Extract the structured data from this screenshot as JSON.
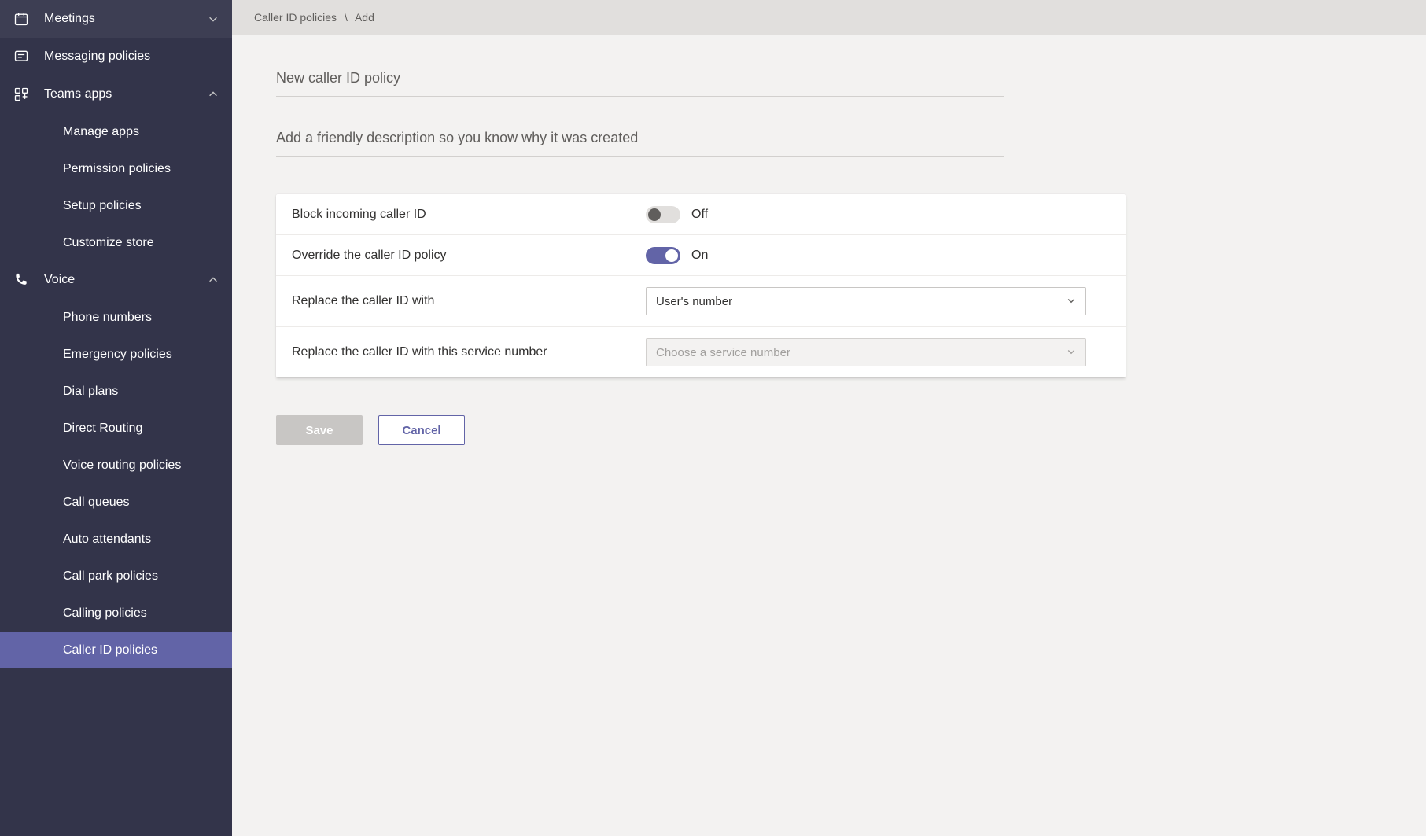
{
  "breadcrumb": {
    "root": "Caller ID policies",
    "current": "Add"
  },
  "inputs": {
    "name_placeholder": "New caller ID policy",
    "desc_placeholder": "Add a friendly description so you know why it was created"
  },
  "settings": {
    "block_incoming": {
      "label": "Block incoming caller ID",
      "state": "Off",
      "on": false
    },
    "override_policy": {
      "label": "Override the caller ID policy",
      "state": "On",
      "on": true
    },
    "replace_with": {
      "label": "Replace the caller ID with",
      "selected": "User's number"
    },
    "service_number": {
      "label": "Replace the caller ID with this service number",
      "placeholder": "Choose a service number"
    }
  },
  "buttons": {
    "save": "Save",
    "cancel": "Cancel"
  },
  "sidebar": {
    "meetings": "Meetings",
    "messaging_policies": "Messaging policies",
    "teams_apps": "Teams apps",
    "teams_apps_children": {
      "manage_apps": "Manage apps",
      "permission_policies": "Permission policies",
      "setup_policies": "Setup policies",
      "customize_store": "Customize store"
    },
    "voice": "Voice",
    "voice_children": {
      "phone_numbers": "Phone numbers",
      "emergency_policies": "Emergency policies",
      "dial_plans": "Dial plans",
      "direct_routing": "Direct Routing",
      "voice_routing_policies": "Voice routing policies",
      "call_queues": "Call queues",
      "auto_attendants": "Auto attendants",
      "call_park_policies": "Call park policies",
      "calling_policies": "Calling policies",
      "caller_id_policies": "Caller ID policies"
    }
  }
}
